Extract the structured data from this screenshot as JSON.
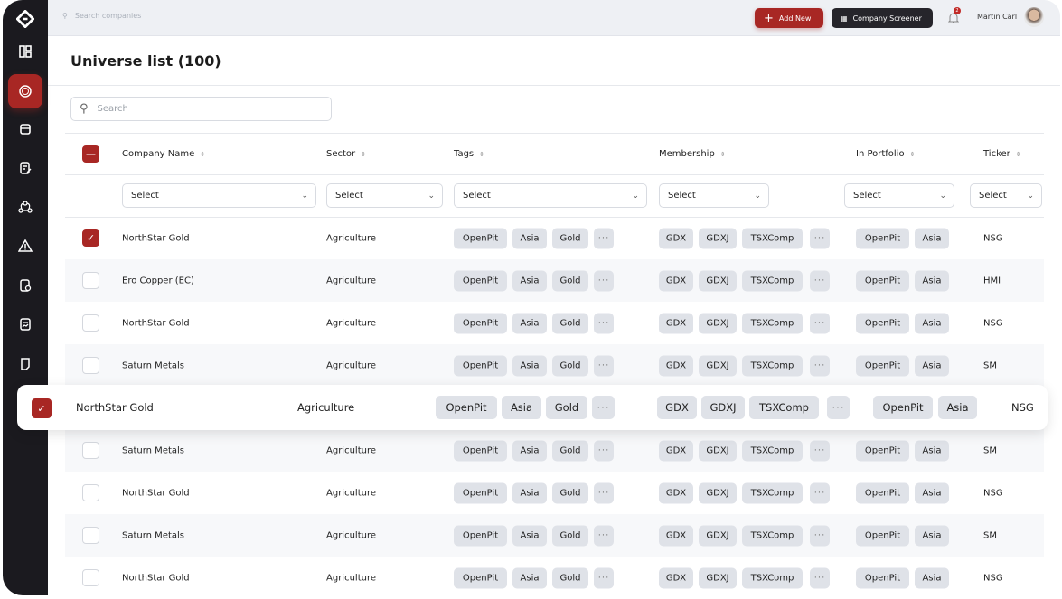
{
  "app": {
    "accent": "#a82724"
  },
  "topbar": {
    "search_placeholder": "Search companies",
    "add_new": "Add New",
    "company_screener": "Company Screener",
    "notification_count": "2",
    "user_name": "Martin Carl"
  },
  "sidebar": {
    "items": [
      "dashboard-icon",
      "universe-icon",
      "box-icon",
      "edit-doc-icon",
      "network-icon",
      "warning-icon",
      "doc-clock-icon",
      "chart-doc-icon",
      "page-icon"
    ],
    "active": 1
  },
  "page": {
    "title": "Universe list (100)",
    "search_placeholder": "Search"
  },
  "table": {
    "columns": [
      "Company Name",
      "Sector",
      "Tags",
      "Membership",
      "In Portfolio",
      "Ticker"
    ],
    "filter_placeholder": "Select",
    "more": "···",
    "rows": [
      {
        "checked": true,
        "name": "NorthStar Gold",
        "sector": "Agriculture",
        "tags": [
          "OpenPit",
          "Asia",
          "Gold"
        ],
        "membership": [
          "GDX",
          "GDXJ",
          "TSXComp"
        ],
        "portfolio": [
          "OpenPit",
          "Asia"
        ],
        "ticker": "NSG"
      },
      {
        "checked": false,
        "name": "Ero Copper (EC)",
        "sector": "Agriculture",
        "tags": [
          "OpenPit",
          "Asia",
          "Gold"
        ],
        "membership": [
          "GDX",
          "GDXJ",
          "TSXComp"
        ],
        "portfolio": [
          "OpenPit",
          "Asia"
        ],
        "ticker": "HMI"
      },
      {
        "checked": false,
        "name": "NorthStar Gold",
        "sector": "Agriculture",
        "tags": [
          "OpenPit",
          "Asia",
          "Gold"
        ],
        "membership": [
          "GDX",
          "GDXJ",
          "TSXComp"
        ],
        "portfolio": [
          "OpenPit",
          "Asia"
        ],
        "ticker": "NSG"
      },
      {
        "checked": false,
        "name": "Saturn Metals",
        "sector": "Agriculture",
        "tags": [
          "OpenPit",
          "Asia",
          "Gold"
        ],
        "membership": [
          "GDX",
          "GDXJ",
          "TSXComp"
        ],
        "portfolio": [
          "OpenPit",
          "Asia"
        ],
        "ticker": "SM"
      },
      {
        "checked": true,
        "name": "NorthStar Gold",
        "sector": "Agriculture",
        "tags": [
          "OpenPit",
          "Asia",
          "Gold"
        ],
        "membership": [
          "GDX",
          "GDXJ",
          "TSXComp"
        ],
        "portfolio": [
          "OpenPit",
          "Asia"
        ],
        "ticker": "NSG"
      },
      {
        "checked": false,
        "name": "Saturn Metals",
        "sector": "Agriculture",
        "tags": [
          "OpenPit",
          "Asia",
          "Gold"
        ],
        "membership": [
          "GDX",
          "GDXJ",
          "TSXComp"
        ],
        "portfolio": [
          "OpenPit",
          "Asia"
        ],
        "ticker": "SM"
      },
      {
        "checked": false,
        "name": "NorthStar Gold",
        "sector": "Agriculture",
        "tags": [
          "OpenPit",
          "Asia",
          "Gold"
        ],
        "membership": [
          "GDX",
          "GDXJ",
          "TSXComp"
        ],
        "portfolio": [
          "OpenPit",
          "Asia"
        ],
        "ticker": "NSG"
      },
      {
        "checked": false,
        "name": "Saturn Metals",
        "sector": "Agriculture",
        "tags": [
          "OpenPit",
          "Asia",
          "Gold"
        ],
        "membership": [
          "GDX",
          "GDXJ",
          "TSXComp"
        ],
        "portfolio": [
          "OpenPit",
          "Asia"
        ],
        "ticker": "SM"
      },
      {
        "checked": false,
        "name": "NorthStar Gold",
        "sector": "Agriculture",
        "tags": [
          "OpenPit",
          "Asia",
          "Gold"
        ],
        "membership": [
          "GDX",
          "GDXJ",
          "TSXComp"
        ],
        "portfolio": [
          "OpenPit",
          "Asia"
        ],
        "ticker": "NSG"
      }
    ],
    "highlighted_row": 4
  }
}
